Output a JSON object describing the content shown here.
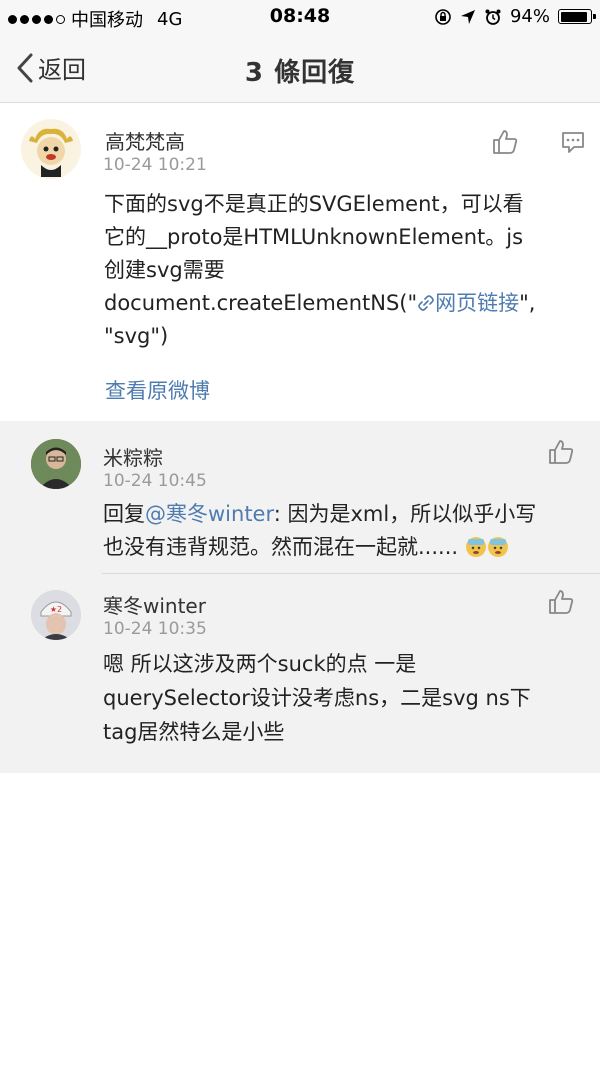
{
  "status_bar": {
    "carrier": "中国移动",
    "network": "4G",
    "time": "08:48",
    "battery": "94%",
    "battery_level": 0.94
  },
  "nav": {
    "back_label": "返回",
    "title": "3 條回復"
  },
  "post": {
    "author": "高梵梵高",
    "time": "10-24 10:21",
    "text_1": "下面的svg不是真正的SVGElement，可以看",
    "text_2": "它的__proto是HTMLUnknownElement。js",
    "text_3": "创建svg需要",
    "text_4a": "document.createElementNS(\"",
    "link_label": "网页链接",
    "text_4b": "\",",
    "text_5": "\"svg\")",
    "view_original": "查看原微博"
  },
  "replies": [
    {
      "author": "米粽粽",
      "time": "10-24 10:45",
      "prefix": "回复",
      "mention": "@寒冬winter",
      "text_1": ": 因为是xml，所以似乎小写",
      "text_2": "也没有违背规范。然而混在一起就......"
    },
    {
      "author": "寒冬winter",
      "time": "10-24 10:35",
      "text_1": "嗯 所以这涉及两个suck的点 一是",
      "text_2": "querySelector设计没考虑ns，二是svg ns下",
      "text_3": "tag居然特么是小些"
    }
  ],
  "colors": {
    "link": "#4f7cb0",
    "reply_bg": "#f2f2f2",
    "meta_gray": "#9a9a9a"
  },
  "icons": [
    "back-chevron-icon",
    "thumbs-up-icon",
    "comment-icon",
    "link-icon",
    "dizzy-emoji-icon",
    "signal-dots-icon",
    "battery-icon"
  ]
}
